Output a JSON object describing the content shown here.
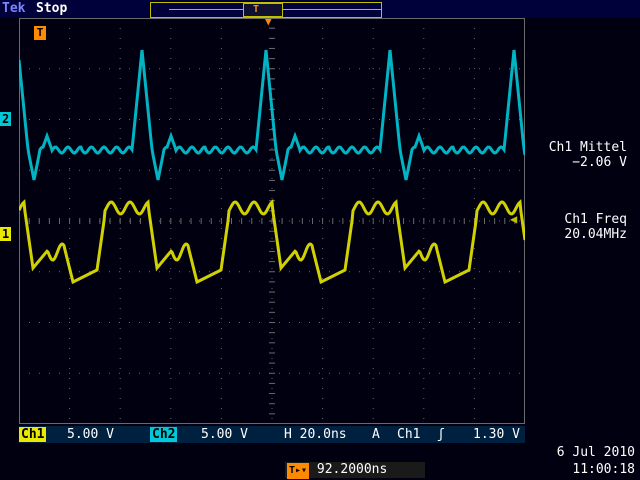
{
  "header": {
    "brand": "Tek",
    "acq_state": "Stop"
  },
  "channel_markers": {
    "ch2": "2",
    "ch1": "1",
    "trigger_marker": "T"
  },
  "measurements": [
    {
      "label": "Ch1 Mittel",
      "value": "−2.06 V"
    },
    {
      "label": "Ch1 Freq",
      "value": "20.04MHz"
    }
  ],
  "bottom": {
    "ch1_label": "Ch1",
    "ch1_scale": "5.00 V",
    "ch2_label": "Ch2",
    "ch2_scale": "5.00 V",
    "timebase": "H 20.0ns",
    "trigger_mode": "A",
    "trigger_source": "Ch1",
    "trigger_slope": "ʃ",
    "trigger_level": "1.30 V"
  },
  "trigger_position": {
    "value": "92.2000ns"
  },
  "datetime": {
    "date": "6 Jul  2010",
    "time": "11:00:18"
  },
  "colors": {
    "ch1": "#e8e800",
    "ch2": "#00c8d8",
    "trigger": "#ff8a00",
    "grid": "#6a6a6a",
    "background": "#000010"
  }
}
